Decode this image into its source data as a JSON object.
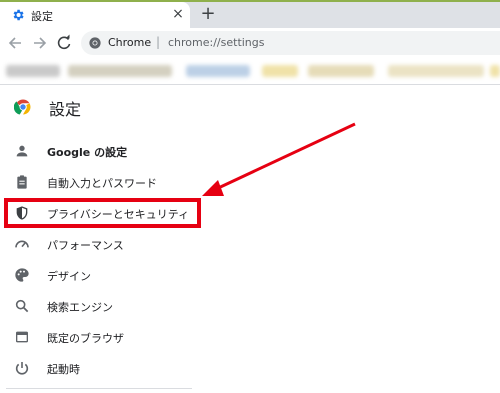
{
  "browser": {
    "tab_title": "設定",
    "tab_close": "×",
    "new_tab": "+",
    "omnibox_site": "Chrome",
    "omnibox_separator": "|",
    "omnibox_url": "chrome://settings"
  },
  "settings": {
    "title": "設定",
    "items": [
      {
        "label": "Google の設定",
        "icon": "person-icon"
      },
      {
        "label": "自動入力とパスワード",
        "icon": "clipboard-icon"
      },
      {
        "label": "プライバシーとセキュリティ",
        "icon": "shield-icon"
      },
      {
        "label": "パフォーマンス",
        "icon": "speedometer-icon"
      },
      {
        "label": "デザイン",
        "icon": "palette-icon"
      },
      {
        "label": "検索エンジン",
        "icon": "search-icon"
      },
      {
        "label": "既定のブラウザ",
        "icon": "browser-window-icon"
      },
      {
        "label": "起動時",
        "icon": "power-icon"
      }
    ]
  },
  "annotation": {
    "highlight_color": "#e60012"
  }
}
